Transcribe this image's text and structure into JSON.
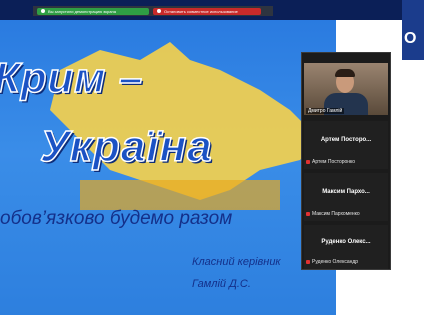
{
  "share_toolbar": {
    "show_label": "Вы запустили демонстрацию экрана",
    "stop_label": "Остановить совместное использование"
  },
  "slide": {
    "title_line1": "Крим –",
    "title_line2": "Україна",
    "subtitle": "обов’язково будемо разом",
    "teacher_role": "Класний керівник",
    "teacher_name": "Гамлій Д.С."
  },
  "participants": [
    {
      "display": "",
      "name": "Дмитро Гамлій",
      "video": true
    },
    {
      "display": "Артем Посторо...",
      "name": "Артем Посторонко",
      "video": false
    },
    {
      "display": "Максим Пархо...",
      "name": "Максим Пархоменко",
      "video": false
    },
    {
      "display": "Руденко Олекс...",
      "name": "Руденко Олександр",
      "video": false
    }
  ],
  "colors": {
    "slide_blue": "#2a7be0",
    "title_blue": "#1b52c4",
    "crimea_yellow": "#f7d24a",
    "panel_bg": "#1b1b1b"
  }
}
